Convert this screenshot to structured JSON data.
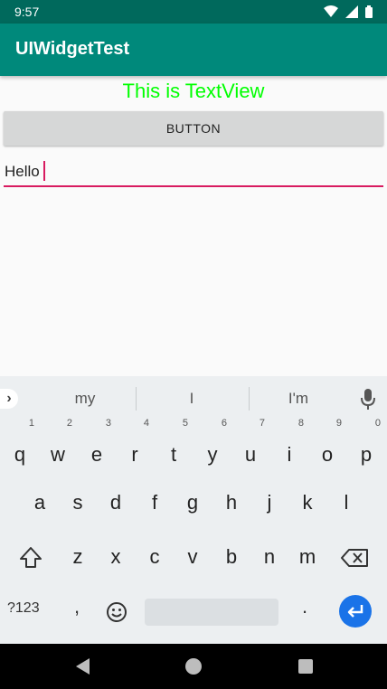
{
  "status": {
    "time": "9:57"
  },
  "app": {
    "title": "UIWidgetTest"
  },
  "content": {
    "textview": "This is TextView",
    "button_label": "BUTTON",
    "edittext_value": "Hello"
  },
  "keyboard": {
    "suggestions": [
      "my",
      "I",
      "I'm"
    ],
    "row_q": [
      {
        "k": "q",
        "h": "1"
      },
      {
        "k": "w",
        "h": "2"
      },
      {
        "k": "e",
        "h": "3"
      },
      {
        "k": "r",
        "h": "4"
      },
      {
        "k": "t",
        "h": "5"
      },
      {
        "k": "y",
        "h": "6"
      },
      {
        "k": "u",
        "h": "7"
      },
      {
        "k": "i",
        "h": "8"
      },
      {
        "k": "o",
        "h": "9"
      },
      {
        "k": "p",
        "h": "0"
      }
    ],
    "row_a": [
      "a",
      "s",
      "d",
      "f",
      "g",
      "h",
      "j",
      "k",
      "l"
    ],
    "row_z": [
      "z",
      "x",
      "c",
      "v",
      "b",
      "n",
      "m"
    ],
    "symbols_label": "?123",
    "comma": ",",
    "period": "."
  },
  "colors": {
    "status_bar": "#00695c",
    "app_bar": "#00897b",
    "textview": "#00ff00",
    "accent": "#d81b60",
    "enter_key": "#1a73e8"
  },
  "icons": [
    "wifi-icon",
    "signal-icon",
    "battery-icon",
    "chevron-right-icon",
    "microphone-icon",
    "shift-icon",
    "backspace-icon",
    "emoji-icon",
    "enter-icon",
    "nav-back-icon",
    "nav-home-icon",
    "nav-recents-icon"
  ]
}
